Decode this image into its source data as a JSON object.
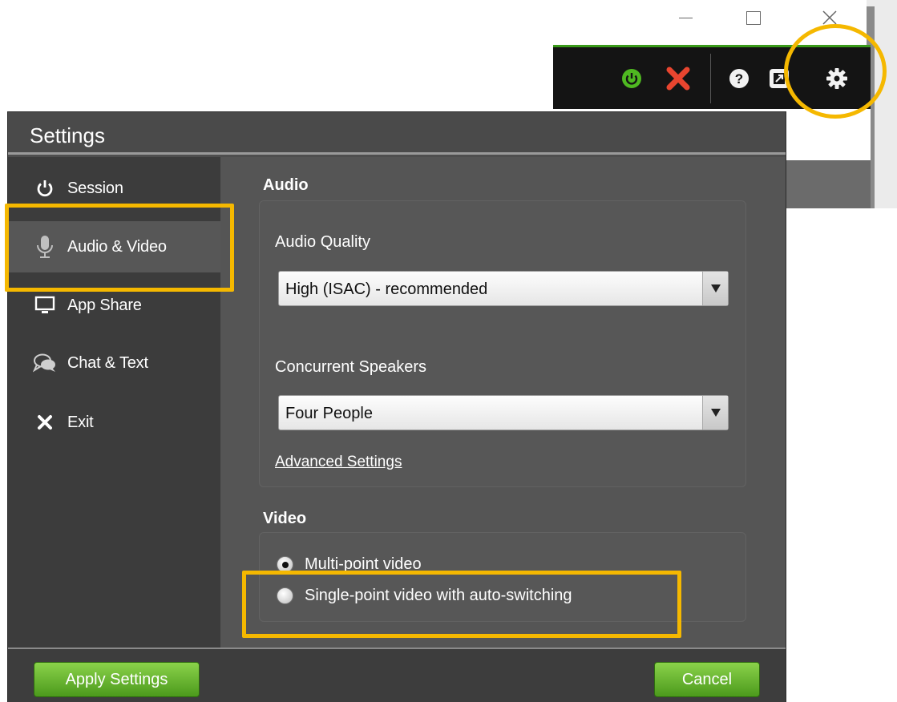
{
  "background_window": {
    "toolbar_icons": [
      "power-icon",
      "red-x-icon",
      "help-icon",
      "popout-icon",
      "gear-icon"
    ],
    "accent": "#3a9a1a"
  },
  "dialog": {
    "title": "Settings",
    "sidebar": {
      "items": [
        {
          "label": "Session",
          "icon": "power-icon"
        },
        {
          "label": "Audio & Video",
          "icon": "microphone-icon",
          "active": true
        },
        {
          "label": "App Share",
          "icon": "monitor-icon"
        },
        {
          "label": "Chat & Text",
          "icon": "chat-bubbles-icon"
        },
        {
          "label": "Exit",
          "icon": "x-icon"
        }
      ]
    },
    "audio": {
      "heading": "Audio",
      "quality_label": "Audio Quality",
      "quality_value": "High (ISAC) - recommended",
      "speakers_label": "Concurrent Speakers",
      "speakers_value": "Four People",
      "advanced_link": "Advanced Settings"
    },
    "video": {
      "heading": "Video",
      "options": [
        {
          "label": "Multi-point video",
          "selected": true
        },
        {
          "label": "Single-point video with auto-switching",
          "selected": false
        }
      ]
    },
    "footer": {
      "apply_label": "Apply Settings",
      "cancel_label": "Cancel"
    }
  },
  "colors": {
    "highlight": "#f5b800",
    "button_green": "#5fae2a",
    "dialog_bg": "#4e4e4e"
  }
}
